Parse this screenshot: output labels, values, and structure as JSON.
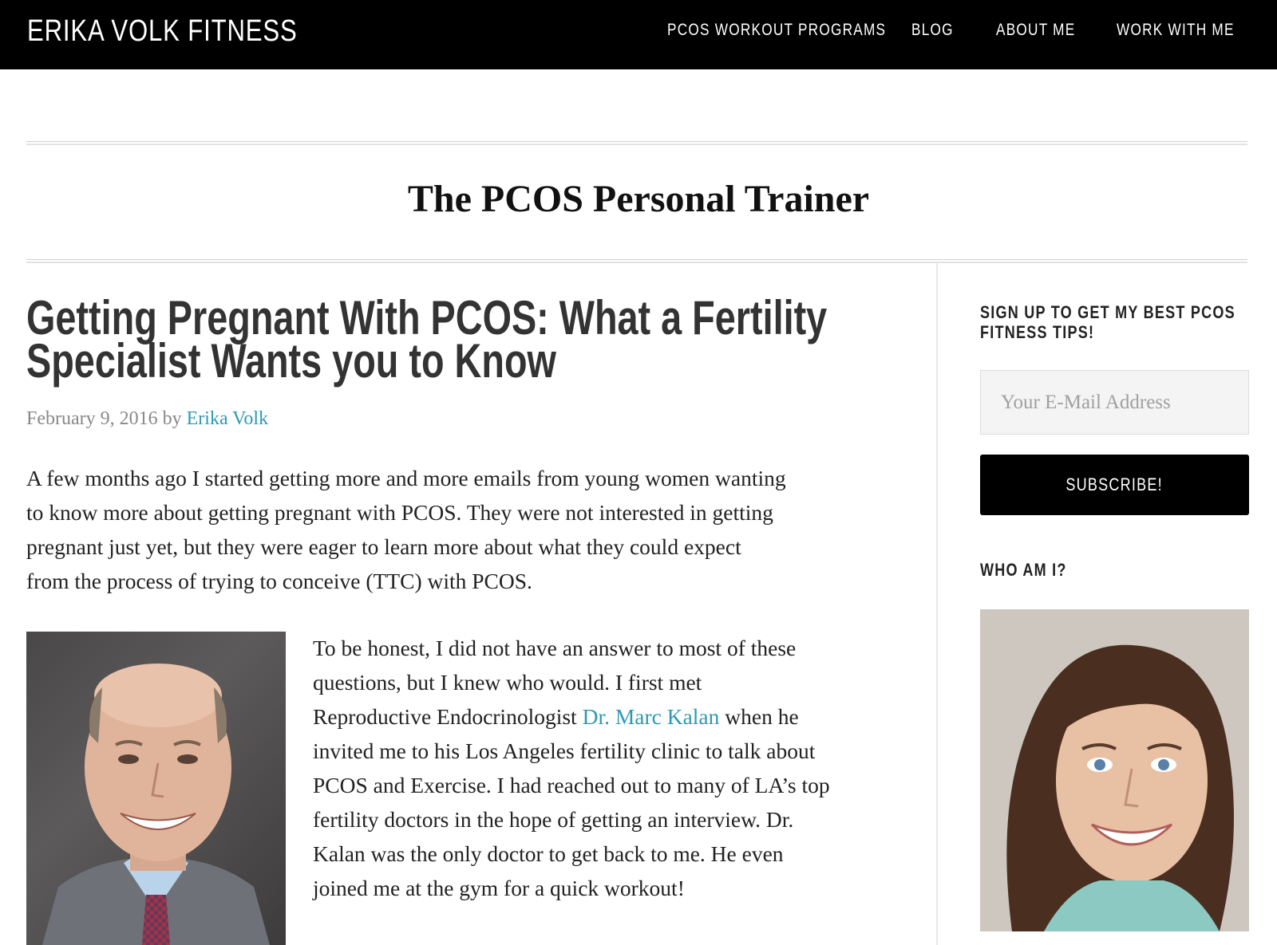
{
  "header": {
    "site_title": "ERIKA VOLK FITNESS",
    "nav": [
      {
        "label": "PCOS WORKOUT PROGRAMS"
      },
      {
        "label": "BLOG"
      },
      {
        "label": "ABOUT ME"
      },
      {
        "label": "WORK WITH ME"
      }
    ]
  },
  "archive": {
    "title": "The PCOS Personal Trainer"
  },
  "post": {
    "title_lines": [
      "Getting Pregnant With PCOS: What a Fertility",
      "Specialist Wants you to Know"
    ],
    "date": "February 9, 2016",
    "by": " by ",
    "author": "Erika Volk",
    "para1_lines": [
      "A few months ago I started getting more and more emails from young women wanting",
      "to know more about getting pregnant with PCOS. They were not interested in getting",
      "pregnant just yet, but they were eager to learn more about what they could expect",
      "from the process of trying to conceive (TTC) with PCOS."
    ],
    "para2": {
      "line1": "To be honest, I did not have an answer to most of these",
      "line2": "questions, but I knew who would. I first met",
      "line3_before": "Reproductive Endocrinologist ",
      "line3_link": "Dr. Marc Kalan",
      "line3_after": " when he",
      "line4": "invited me to his Los Angeles fertility clinic to talk about",
      "line5": "PCOS and Exercise. I had reached out to many of LA’s top",
      "line6": "fertility doctors in the hope of getting an interview. Dr.",
      "line7": "Kalan was the only doctor to get back to me. He even",
      "line8": "joined me at the gym for a quick workout!"
    },
    "doctor_photo_icon": "doctor-portrait-photo"
  },
  "sidebar": {
    "signup_title_lines": [
      "SIGN UP TO GET MY BEST PCOS",
      "FITNESS TIPS!"
    ],
    "email_placeholder": "Your E-Mail Address",
    "subscribe_label": "SUBSCRIBE!",
    "who_title": "WHO AM I?",
    "author_photo_icon": "author-portrait-photo"
  },
  "colors": {
    "header_bg": "#000000",
    "link": "#2d9ab5",
    "meta": "#888888",
    "button_bg": "#000000"
  }
}
